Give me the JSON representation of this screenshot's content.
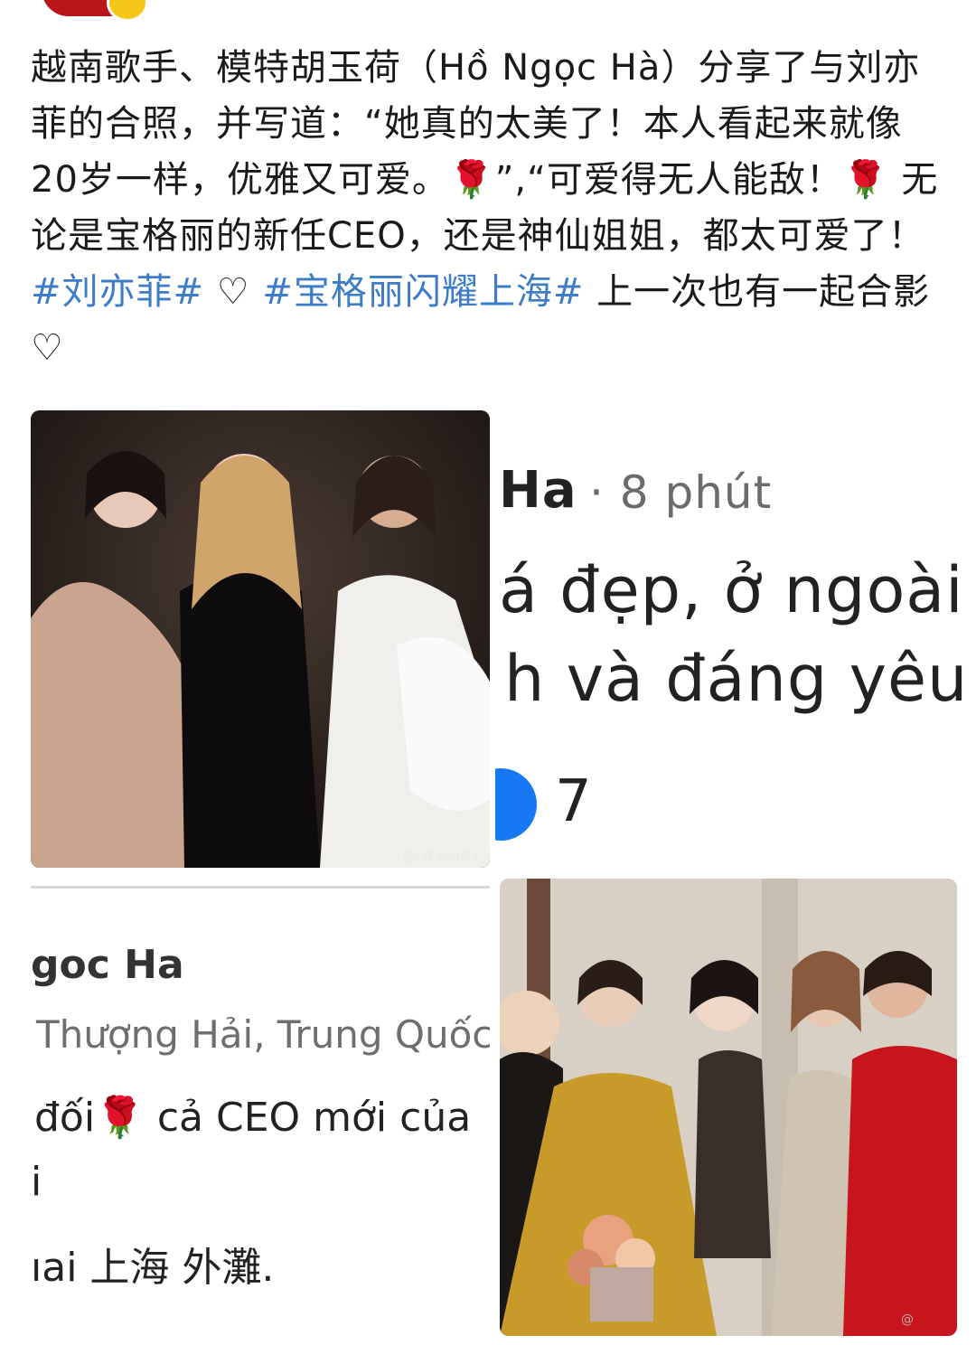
{
  "post": {
    "segments": [
      {
        "text": "越南歌手、模特胡玉荷（Hồ Ngọc Hà）分享了与刘亦菲的合照，并写道：“她真的太美了！本人看起来就像20岁一样，优雅又可爱。🌹”,“可爱得无人能敌！🌹 无论是宝格丽的新任CEO，还是神仙姐姐，都太可爱了！",
        "type": "text"
      },
      {
        "text": "#刘亦菲#",
        "type": "hashtag"
      },
      {
        "text": " ♡",
        "type": "text"
      },
      {
        "text": "#宝格丽闪耀上海#",
        "type": "hashtag"
      },
      {
        "text": " 上一次也有一起合影♡",
        "type": "text"
      }
    ]
  },
  "photo1": {
    "watermark": "@LYFVietNa"
  },
  "screenshot_top": {
    "name": "Ha",
    "time": "· 8 phút",
    "line1": "á đẹp, ở ngoài",
    "line2": "h và đáng yêu",
    "like_count": "7"
  },
  "screenshot_bottom": {
    "name": "goc Ha",
    "location": "Thượng Hải, Trung Quốc",
    "line1": "đối🌹 cả CEO mới của",
    "line2": "i",
    "line3": "ıai 上海 外灘."
  },
  "colors": {
    "hashtag": "#3d7cc9",
    "like": "#1877f2"
  }
}
